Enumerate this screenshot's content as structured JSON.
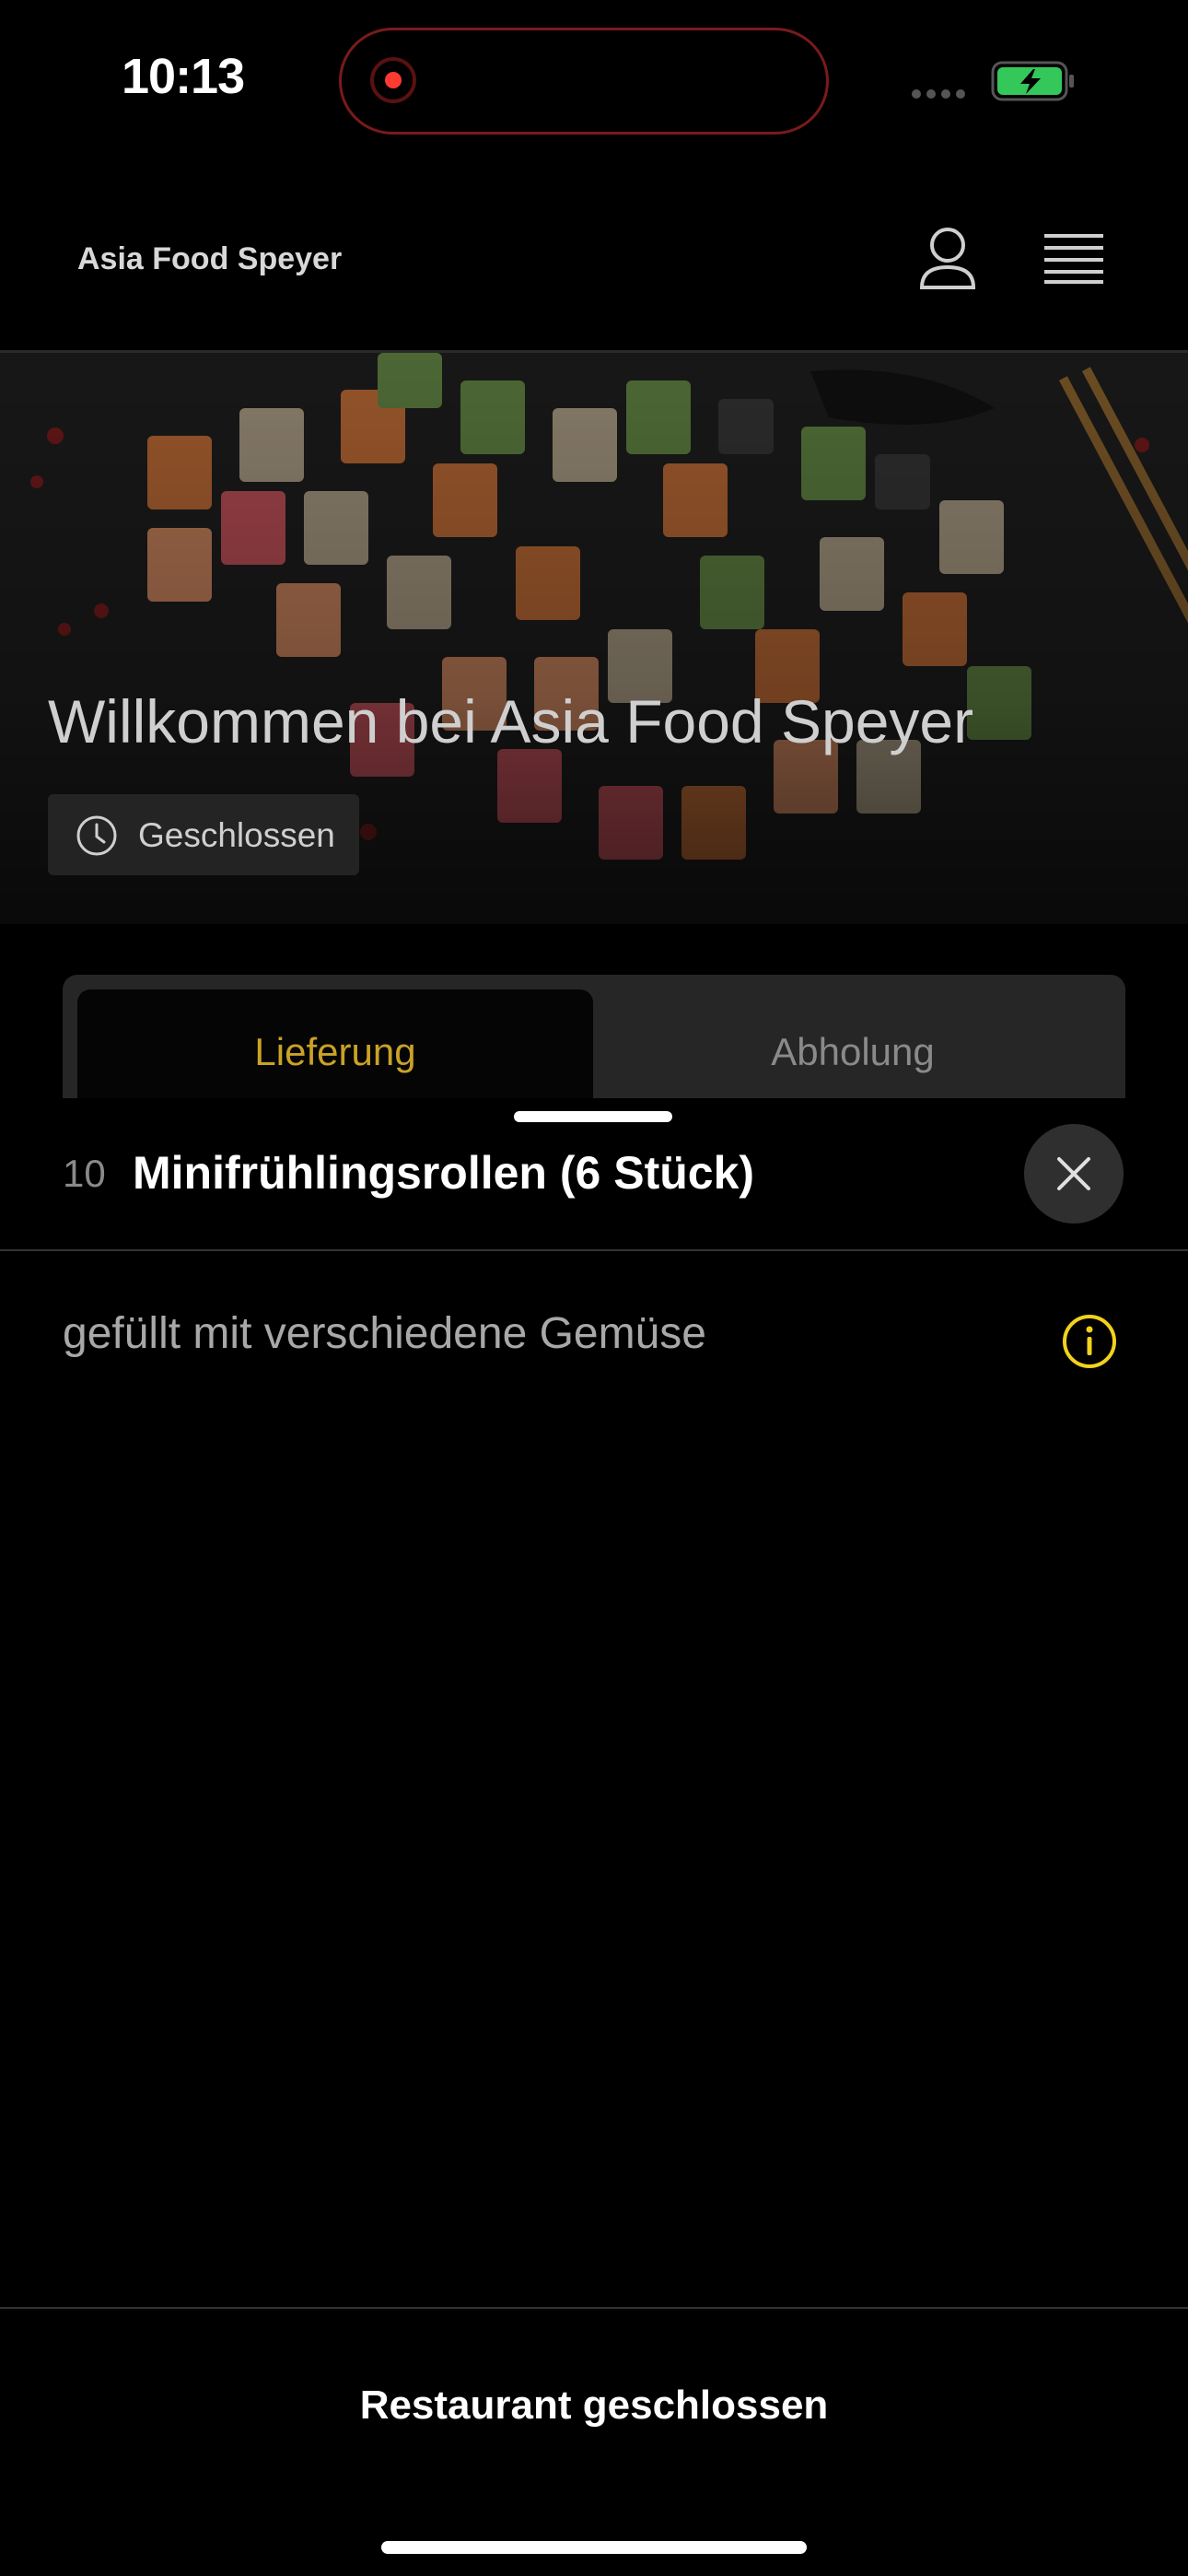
{
  "status_bar": {
    "time": "10:13"
  },
  "header": {
    "title": "Asia Food Speyer"
  },
  "hero": {
    "title": "Willkommen bei Asia Food Speyer",
    "status": "Geschlossen"
  },
  "tabs": [
    {
      "label": "Lieferung",
      "active": true
    },
    {
      "label": "Abholung",
      "active": false
    }
  ],
  "item": {
    "number": "10",
    "name": "Minifrühlingsrollen (6 Stück)",
    "description": "gefüllt mit verschiedene Gemüse"
  },
  "footer": {
    "label": "Restaurant geschlossen"
  },
  "icons": {
    "user": "user-icon",
    "menu": "hamburger-menu-icon",
    "clock": "clock-icon",
    "close": "close-icon",
    "info": "info-icon",
    "battery": "battery-charging-icon"
  },
  "colors": {
    "accent": "#c9a227",
    "info": "#f2d21b",
    "battery": "#34c759",
    "record": "#ff3b30"
  }
}
